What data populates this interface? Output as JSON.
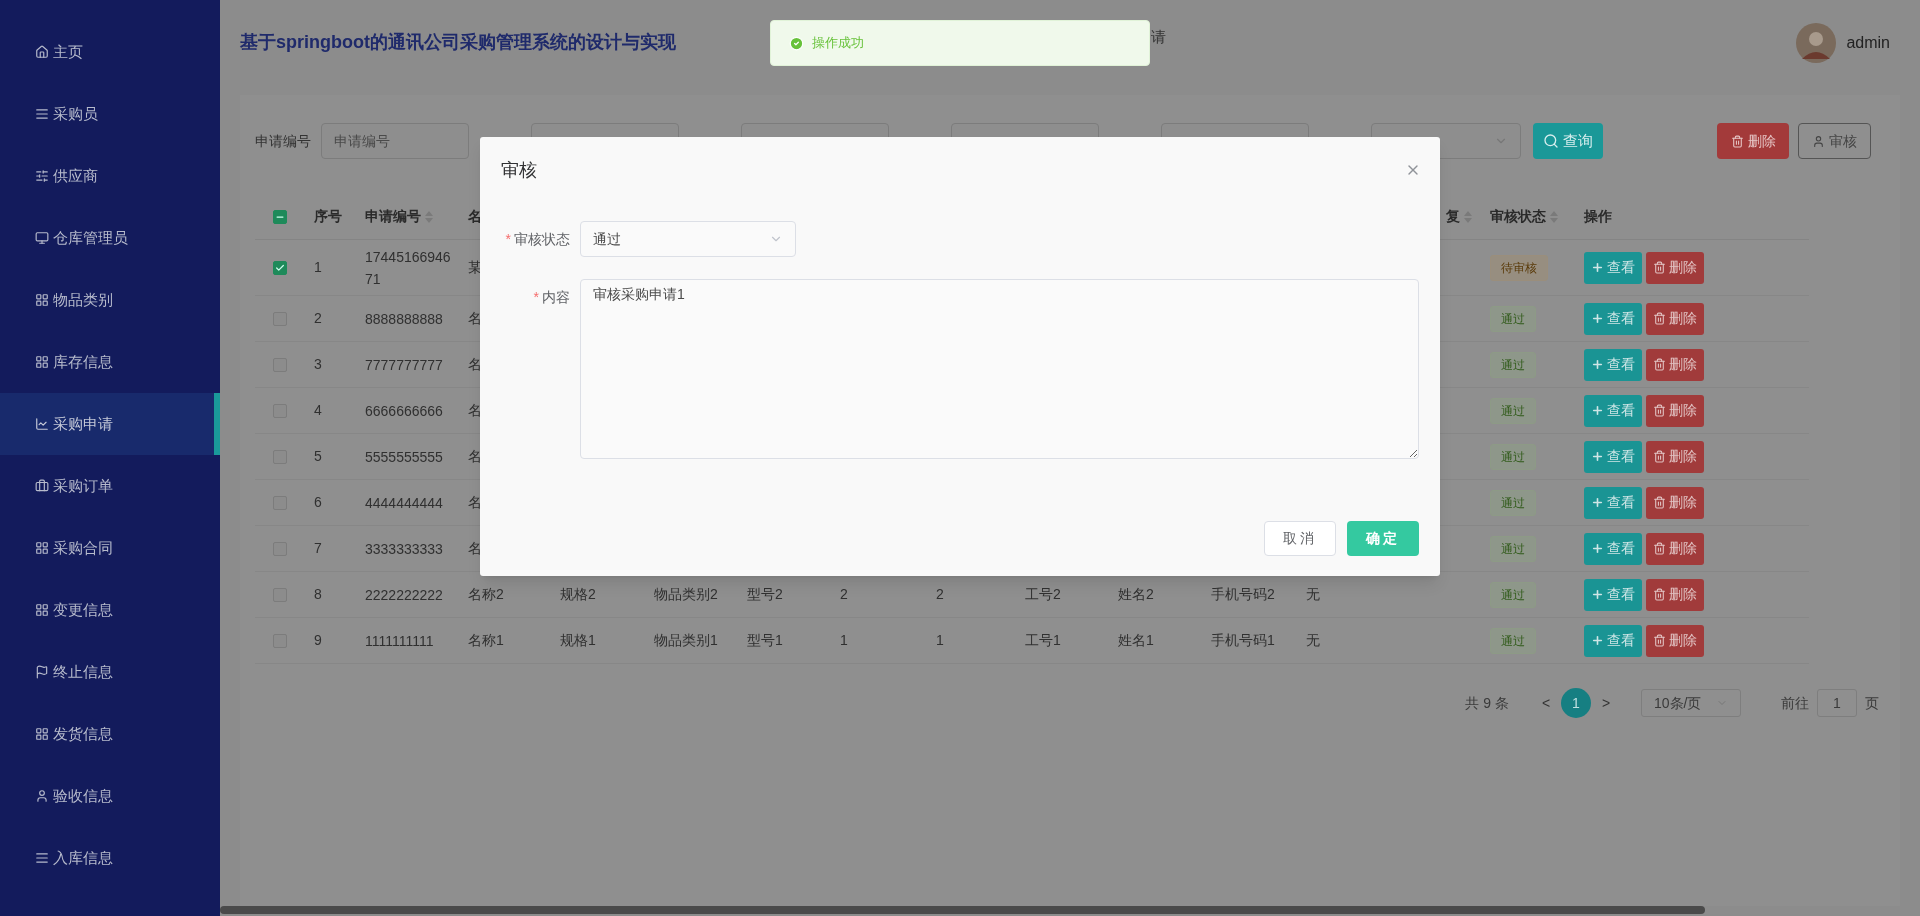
{
  "sidebar": {
    "items": [
      {
        "label": "主页",
        "selected": false
      },
      {
        "label": "采购员",
        "selected": false
      },
      {
        "label": "供应商",
        "selected": false
      },
      {
        "label": "仓库管理员",
        "selected": false
      },
      {
        "label": "物品类别",
        "selected": false
      },
      {
        "label": "库存信息",
        "selected": false
      },
      {
        "label": "采购申请",
        "selected": true
      },
      {
        "label": "采购订单",
        "selected": false
      },
      {
        "label": "采购合同",
        "selected": false
      },
      {
        "label": "变更信息",
        "selected": false
      },
      {
        "label": "终止信息",
        "selected": false
      },
      {
        "label": "发货信息",
        "selected": false
      },
      {
        "label": "验收信息",
        "selected": false
      },
      {
        "label": "入库信息",
        "selected": false
      }
    ]
  },
  "header": {
    "title": "基于springboot的通讯公司采购管理系统的设计与实现",
    "breadcrumb": "请",
    "user": "admin"
  },
  "toast": {
    "kind": "success",
    "text": "操作成功"
  },
  "filters": [
    {
      "kind": "input",
      "label": "申请编号",
      "placeholder": "申请编号"
    },
    {
      "kind": "input"
    },
    {
      "kind": "input"
    },
    {
      "kind": "input"
    },
    {
      "kind": "input"
    },
    {
      "kind": "select"
    }
  ],
  "toolbar": {
    "search": "查询",
    "delete": "删除",
    "review": "审核"
  },
  "table": {
    "select_all_indeterminate": true,
    "columns": {
      "index": {
        "label": "序号"
      },
      "number": {
        "label": "申请编号",
        "sortable": true
      },
      "name": {
        "label": "名"
      },
      "reply": {
        "label": "复",
        "sortable": true
      },
      "status": {
        "label": "审核状态",
        "sortable": true
      },
      "actions": {
        "label": "操作"
      }
    },
    "rows": [
      {
        "checked": true,
        "index": "1",
        "number": "1744516694671",
        "name": "某",
        "status": {
          "kind": "pending",
          "text": "待审核"
        },
        "actions": [
          "查看",
          "删除"
        ]
      },
      {
        "checked": false,
        "index": "2",
        "number": "8888888888",
        "name": "名",
        "status": {
          "kind": "passed",
          "text": "通过"
        },
        "actions": [
          "查看",
          "删除"
        ]
      },
      {
        "checked": false,
        "index": "3",
        "number": "7777777777",
        "name": "名",
        "status": {
          "kind": "passed",
          "text": "通过"
        },
        "actions": [
          "查看",
          "删除"
        ]
      },
      {
        "checked": false,
        "index": "4",
        "number": "6666666666",
        "name": "名",
        "status": {
          "kind": "passed",
          "text": "通过"
        },
        "actions": [
          "查看",
          "删除"
        ]
      },
      {
        "checked": false,
        "index": "5",
        "number": "5555555555",
        "name": "名",
        "status": {
          "kind": "passed",
          "text": "通过"
        },
        "actions": [
          "查看",
          "删除"
        ]
      },
      {
        "checked": false,
        "index": "6",
        "number": "4444444444",
        "name": "名",
        "status": {
          "kind": "passed",
          "text": "通过"
        },
        "actions": [
          "查看",
          "删除"
        ]
      },
      {
        "checked": false,
        "index": "7",
        "number": "3333333333",
        "name": "名",
        "status": {
          "kind": "passed",
          "text": "通过"
        },
        "actions": [
          "查看",
          "删除"
        ]
      },
      {
        "checked": false,
        "index": "8",
        "number": "2222222222",
        "name": "名称2",
        "spec": "规格2",
        "category": "物品类别2",
        "model": "型号2",
        "column_7": "2",
        "column_8": "2",
        "staff_no": "工号2",
        "staff_name": "姓名2",
        "phone": "手机号码2",
        "reply": "无",
        "status": {
          "kind": "passed",
          "text": "通过"
        },
        "actions": [
          "查看",
          "删除"
        ]
      },
      {
        "checked": false,
        "index": "9",
        "number": "1111111111",
        "name": "名称1",
        "spec": "规格1",
        "category": "物品类别1",
        "model": "型号1",
        "column_7": "1",
        "column_8": "1",
        "staff_no": "工号1",
        "staff_name": "姓名1",
        "phone": "手机号码1",
        "reply": "无",
        "status": {
          "kind": "passed",
          "text": "通过"
        },
        "actions": [
          "查看",
          "删除"
        ]
      }
    ]
  },
  "pagination": {
    "total": "共 9 条",
    "prev": "<",
    "pages": [
      {
        "label": "1",
        "selected": true
      }
    ],
    "next": ">",
    "page_size": "10条/页",
    "goto_label": "前往",
    "goto_value": "1",
    "goto_suffix": "页"
  },
  "modal": {
    "title": "审核",
    "fields": [
      {
        "kind": "select",
        "required_mark": "*",
        "label": "审核状态",
        "value": "通过"
      },
      {
        "kind": "textarea",
        "required_mark": "*",
        "label": "内容",
        "value": "审核采购申请1"
      }
    ],
    "buttons": [
      {
        "kind": "default",
        "label": "取消"
      },
      {
        "kind": "primary",
        "label": "确定"
      }
    ]
  }
}
